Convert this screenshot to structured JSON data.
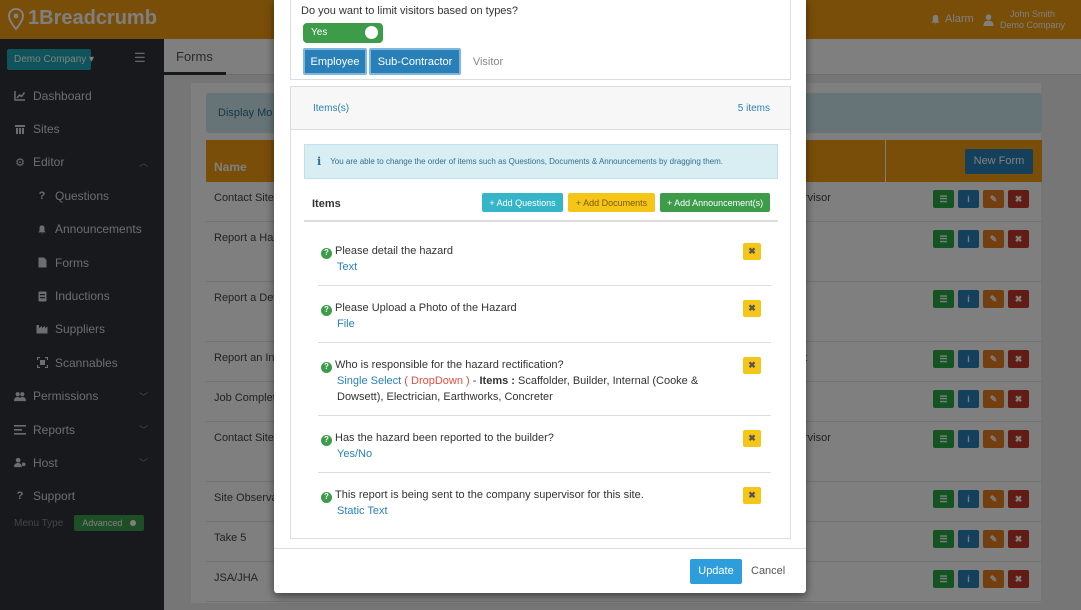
{
  "app": {
    "logo_text": "1Breadcrumb"
  },
  "header": {
    "alarm_label": "Alarm",
    "user_name": "John Smith",
    "user_company": "Demo Company"
  },
  "sidebar": {
    "company_select": "Demo Company",
    "items": [
      {
        "label": "Dashboard",
        "icon": "chart-line-icon"
      },
      {
        "label": "Sites",
        "icon": "building-icon"
      },
      {
        "label": "Editor",
        "icon": "gear-icon"
      },
      {
        "label": "Questions",
        "icon": "question-icon"
      },
      {
        "label": "Announcements",
        "icon": "bell-icon"
      },
      {
        "label": "Forms",
        "icon": "file-icon"
      },
      {
        "label": "Inductions",
        "icon": "id-card-icon"
      },
      {
        "label": "Suppliers",
        "icon": "industry-icon"
      },
      {
        "label": "Scannables",
        "icon": "qrcode-icon"
      },
      {
        "label": "Permissions",
        "icon": "users-icon"
      },
      {
        "label": "Reports",
        "icon": "list-icon"
      },
      {
        "label": "Host",
        "icon": "user-gear-icon"
      },
      {
        "label": "Support",
        "icon": "question-icon"
      }
    ],
    "menu_type_label": "Menu Type",
    "menu_type_value": "Advanced"
  },
  "page": {
    "tab": "Forms",
    "info": "Display Mo",
    "column_name": "Name",
    "new_form": "New Form",
    "rows": [
      {
        "name": "Contact Site",
        "extra": "rvisor"
      },
      {
        "name": "Report a Haz",
        "extra": ""
      },
      {
        "name": "Report a Def",
        "extra": ""
      },
      {
        "name": "Report an Inc",
        "extra": "t"
      },
      {
        "name": "Job Complet",
        "extra": ""
      },
      {
        "name": "Contact Site",
        "extra": "rvisor"
      },
      {
        "name": "Site Observa",
        "extra": ""
      },
      {
        "name": "Take 5",
        "extra": ""
      },
      {
        "name": "JSA/JHA",
        "extra": ""
      }
    ]
  },
  "modal": {
    "limit_question": "Do you want to limit visitors based on types?",
    "toggle_label": "Yes",
    "types": [
      {
        "label": "Employee",
        "selected": true
      },
      {
        "label": "Sub-Contractor",
        "selected": true
      },
      {
        "label": "Visitor",
        "selected": false
      }
    ],
    "items_header_left": "Items(s)",
    "items_header_right": "5 items",
    "note": "You are able to change the order of items such as Questions, Documents & Announcements by dragging them.",
    "items_title": "Items",
    "add_questions": "+ Add Questions",
    "add_documents": "+ Add Documents",
    "add_announcements": "+ Add Announcement(s)",
    "questions": [
      {
        "text": "Please detail the hazard",
        "type": "Text"
      },
      {
        "text": "Please Upload a Photo of the Hazard",
        "type": "File"
      },
      {
        "text": "Who is responsible for the hazard rectification?",
        "type": "Single Select",
        "subtype": "( DropDown )",
        "items_label": "Items :",
        "items_value": "Scaffolder, Builder, Internal (Cooke & Dowsett), Electrician, Earthworks, Concreter"
      },
      {
        "text": "Has the hazard been reported to the builder?",
        "type": "Yes/No"
      },
      {
        "text": "This report is being sent to the company supervisor for this site.",
        "type": "Static Text"
      }
    ],
    "update": "Update",
    "cancel": "Cancel"
  },
  "colors": {
    "brand": "#f39c12",
    "primary": "#2980b9",
    "success": "#3c9c4a",
    "warning": "#f5c518",
    "danger": "#c0392b"
  }
}
